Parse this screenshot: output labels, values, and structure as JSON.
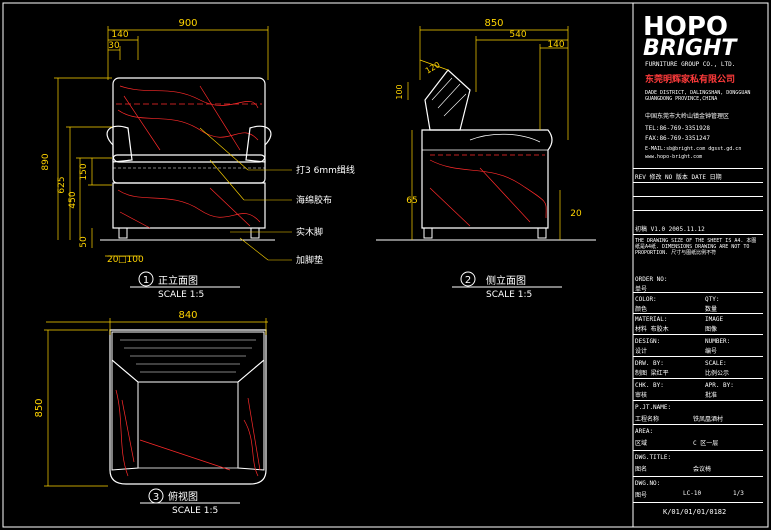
{
  "views": {
    "front": {
      "num": "1",
      "title": "正立面图",
      "scale": "SCALE 1:5"
    },
    "side": {
      "num": "2",
      "title": "侧立面图",
      "scale": "SCALE 1:5"
    },
    "top": {
      "num": "3",
      "title": "俯视图",
      "scale": "SCALE 1:5"
    }
  },
  "dims": {
    "front_width": "900",
    "front_140": "140",
    "front_30": "30",
    "front_height": "890",
    "front_625": "625",
    "front_450": "450",
    "front_150": "150",
    "front_50": "50",
    "front_20": "20",
    "front_sq": "□100",
    "side_width": "850",
    "side_540": "540",
    "side_140": "140",
    "side_120": "120",
    "side_100": "100",
    "side_65": "65",
    "side_20": "20",
    "top_width": "840",
    "top_depth": "850"
  },
  "callouts": [
    "打3 6mm缉线",
    "海绵胶布",
    "实木脚",
    "加脚垫"
  ],
  "colors": {
    "line": "#ffffff",
    "accent": "#ff2a2a",
    "dim": "#ffd400",
    "cad_green": "#00e000"
  },
  "title_block": {
    "logo_line1": "HOPO",
    "logo_line2": "BRIGHT",
    "logo_sub": "FURNITURE GROUP CO., LTD.",
    "company_cn": "东莞明辉家私有限公司",
    "addr_en": "DADE DISTRICT, DALINGSHAN, DONGGUAN GUANGDONG PROVINCE,CHINA",
    "addr_cn": "中国东莞市大岭山镇金钟管理区",
    "tel": "TEL:86-769-3351928",
    "fax": "FAX:86-769-3351247",
    "email": "E-MAIL:sb@bright.com  dgsst.gd.cn",
    "web": "www.hopo-bright.com",
    "rev_header": "REV 修改    NO 版本    DATE 日期",
    "rev_row": "初稿    V1.0    2005.11.12",
    "notes": "THE DRAWING SIZE OF THE SHEET IS A4. 本图纸是A4纸. DIMENSIONS DRAWING ARE NOT TO PROPORTION. 尺寸与图纸比例不符",
    "order_no": "ORDER NO:",
    "order_cn": "单号",
    "color_label": "COLOR:",
    "color_cn": "颜色",
    "qty_label": "QTY:",
    "qty_cn": "数量",
    "material_label": "MATERIAL:",
    "material_cn": "材料 布胶木",
    "image_label": "IMAGE",
    "image_cn": "图像",
    "design_label": "DESIGN:",
    "design_cn": "设计",
    "number_label": "NUMBER:",
    "number_cn": "编号",
    "drw_label": "DRW. BY:",
    "drw_cn": "制图 梁红平",
    "scale_label": "SCALE:",
    "scale_cn": "比例公示",
    "chk_label": "CHK. BY:",
    "chk_cn": "审核",
    "apr_label": "APR. BY:",
    "apr_cn": "批准",
    "pjt_label": "P.JT.NAME:",
    "pjt_cn": "工程名称",
    "pjt_val": "铁凤凰酒村",
    "area_label": "AREA:",
    "area_cn": "区域",
    "area_val": "C 区一层",
    "dwg_label": "DWG.TITLE:",
    "dwg_cn": "图名",
    "dwg_val": "会议椅",
    "dwgno_label": "DWG.NO:",
    "dwgno_cn": "图号",
    "dwgno_val": "LC-10",
    "sheet": "1/3",
    "dwgno_full": "K/01/01/01/0182",
    "blank": "",
    "dots": "·"
  }
}
